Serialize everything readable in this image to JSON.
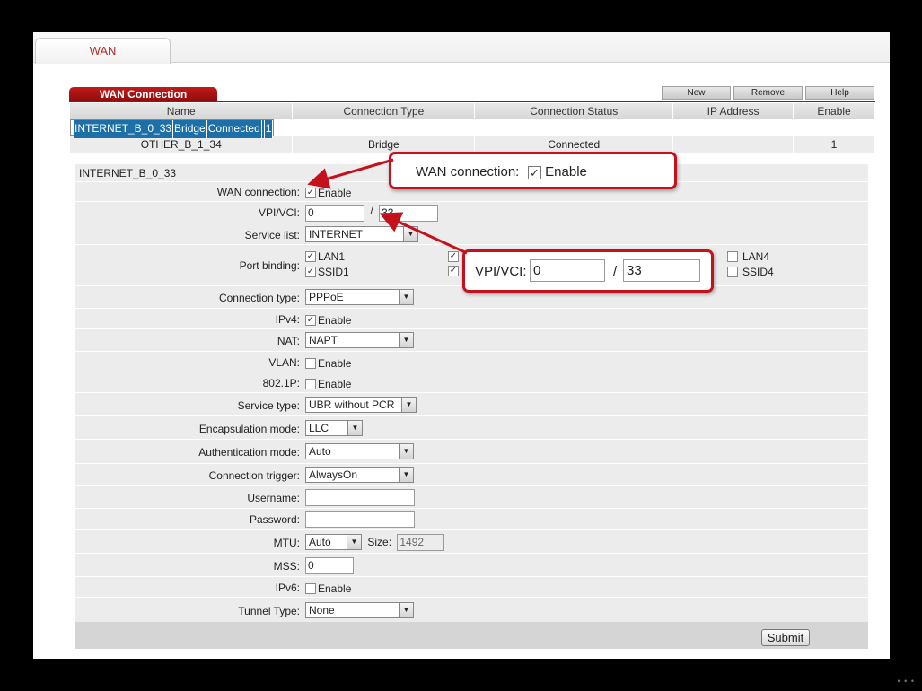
{
  "top_tab": {
    "label": "WAN"
  },
  "wan_connection": {
    "title": "WAN Connection",
    "buttons": {
      "new": "New",
      "remove": "Remove",
      "help": "Help"
    },
    "columns": [
      "Name",
      "Connection Type",
      "Connection Status",
      "IP Address",
      "Enable"
    ],
    "rows": [
      {
        "name": "INTERNET_B_0_33",
        "type": "Bridge",
        "status": "Connected",
        "ip": "",
        "enable": "1"
      },
      {
        "name": "OTHER_B_1_34",
        "type": "Bridge",
        "status": "Connected",
        "ip": "",
        "enable": "1"
      }
    ]
  },
  "form": {
    "title": "INTERNET_B_0_33",
    "wan_connection": {
      "label": "WAN connection:",
      "checkbox_label": "Enable",
      "checked": true
    },
    "vpi_vci": {
      "label": "VPI/VCI:",
      "vpi": "0",
      "separator": "/",
      "vci": "33"
    },
    "service_list": {
      "label": "Service list:",
      "value": "INTERNET"
    },
    "port_binding": {
      "label": "Port binding:",
      "ports": [
        {
          "name": "LAN1",
          "checked": true
        },
        {
          "name": "SSID1",
          "checked": true
        },
        {
          "name": "LAN4",
          "checked": false
        },
        {
          "name": "SSID4",
          "checked": false
        }
      ]
    },
    "connection_type": {
      "label": "Connection type:",
      "value": "PPPoE"
    },
    "ipv4": {
      "label": "IPv4:",
      "checkbox_label": "Enable",
      "checked": true
    },
    "nat": {
      "label": "NAT:",
      "value": "NAPT"
    },
    "vlan": {
      "label": "VLAN:",
      "checkbox_label": "Enable",
      "checked": false
    },
    "dot1p": {
      "label": "802.1P:",
      "checkbox_label": "Enable",
      "checked": false
    },
    "service_type": {
      "label": "Service type:",
      "value": "UBR without PCR"
    },
    "encapsulation": {
      "label": "Encapsulation mode:",
      "value": "LLC"
    },
    "auth_mode": {
      "label": "Authentication mode:",
      "value": "Auto"
    },
    "conn_trigger": {
      "label": "Connection trigger:",
      "value": "AlwaysOn"
    },
    "username": {
      "label": "Username:",
      "value": ""
    },
    "password": {
      "label": "Password:",
      "value": ""
    },
    "mtu": {
      "label": "MTU:",
      "value": "Auto",
      "size_label": "Size:",
      "size_value": "1492"
    },
    "mss": {
      "label": "MSS:",
      "value": "0"
    },
    "ipv6": {
      "label": "IPv6:",
      "checkbox_label": "Enable",
      "checked": false
    },
    "tunnel_type": {
      "label": "Tunnel Type:",
      "value": "None"
    },
    "submit_label": "Submit"
  },
  "callouts": {
    "wan": {
      "label": "WAN connection:",
      "checkbox_label": "Enable"
    },
    "vpi": {
      "label": "VPI/VCI:",
      "vpi": "0",
      "separator": "/",
      "vci": "33"
    }
  },
  "colors": {
    "accent_red": "#c4111b",
    "selected_row": "#1d6fa8",
    "header_red": "#a30f0f"
  },
  "watermark": "• • •"
}
